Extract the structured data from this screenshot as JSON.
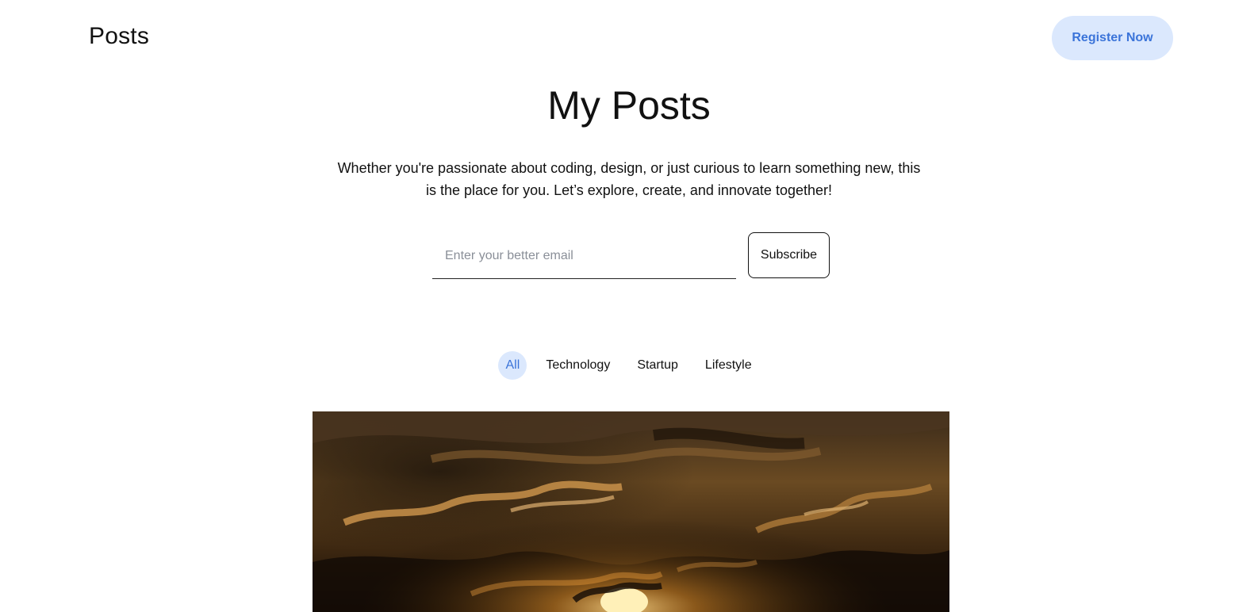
{
  "header": {
    "logo": "Posts",
    "register_label": "Register Now"
  },
  "hero": {
    "title": "My Posts",
    "description": "Whether you're passionate about coding, design, or just curious to learn something new, this is the place for you. Let’s explore, create, and innovate together!"
  },
  "subscribe": {
    "email_placeholder": "Enter your better email",
    "email_value": "",
    "button_label": "Subscribe"
  },
  "tabs": [
    {
      "label": "All",
      "active": true
    },
    {
      "label": "Technology",
      "active": false
    },
    {
      "label": "Startup",
      "active": false
    },
    {
      "label": "Lifestyle",
      "active": false
    }
  ],
  "colors": {
    "accent": "#3b74d9",
    "accent_bg": "#dbe8fd",
    "text": "#111111",
    "placeholder": "#8a8f98"
  }
}
